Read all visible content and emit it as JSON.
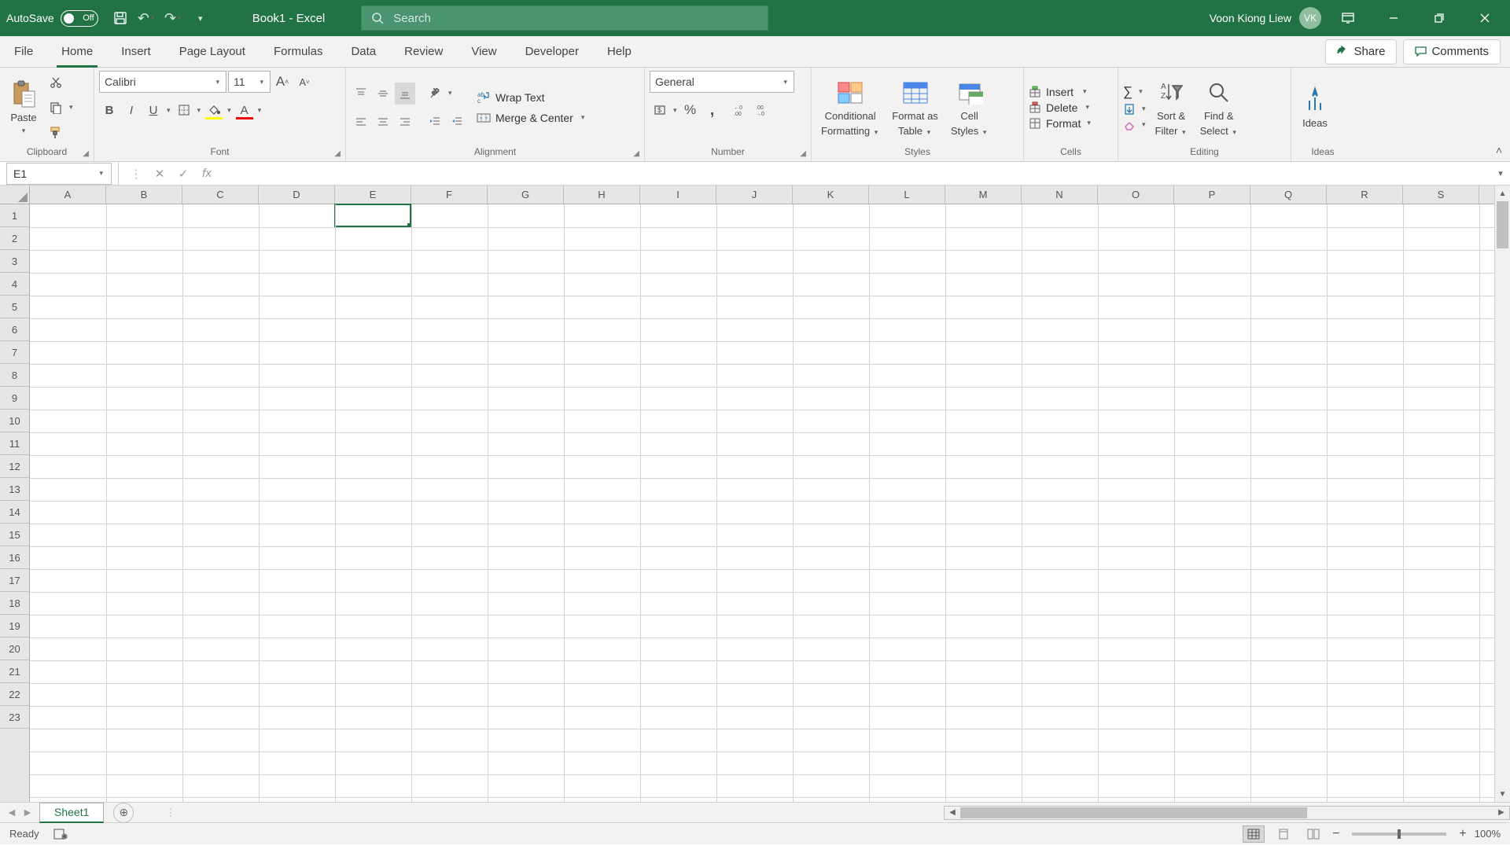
{
  "titlebar": {
    "autosave_label": "AutoSave",
    "autosave_state": "Off",
    "doc_title": "Book1  -  Excel",
    "search_placeholder": "Search",
    "user_name": "Voon Kiong Liew",
    "user_initials": "VK"
  },
  "tabs": [
    "File",
    "Home",
    "Insert",
    "Page Layout",
    "Formulas",
    "Data",
    "Review",
    "View",
    "Developer",
    "Help"
  ],
  "active_tab": "Home",
  "tab_actions": {
    "share": "Share",
    "comments": "Comments"
  },
  "ribbon": {
    "clipboard": {
      "label": "Clipboard",
      "paste": "Paste"
    },
    "font": {
      "label": "Font",
      "name": "Calibri",
      "size": "11"
    },
    "alignment": {
      "label": "Alignment",
      "wrap": "Wrap Text",
      "merge": "Merge & Center"
    },
    "number": {
      "label": "Number",
      "format": "General"
    },
    "styles": {
      "label": "Styles",
      "cond": "Conditional",
      "cond2": "Formatting",
      "fas": "Format as",
      "fas2": "Table",
      "cell": "Cell",
      "cell2": "Styles"
    },
    "cells": {
      "label": "Cells",
      "insert": "Insert",
      "delete": "Delete",
      "format": "Format"
    },
    "editing": {
      "label": "Editing",
      "sort": "Sort &",
      "sort2": "Filter",
      "find": "Find &",
      "find2": "Select"
    },
    "ideas": {
      "label": "Ideas",
      "btn": "Ideas"
    }
  },
  "name_box": "E1",
  "selected_cell": {
    "col": 4,
    "row": 0
  },
  "columns": [
    "A",
    "B",
    "C",
    "D",
    "E",
    "F",
    "G",
    "H",
    "I",
    "J",
    "K",
    "L",
    "M",
    "N",
    "O",
    "P",
    "Q",
    "R",
    "S"
  ],
  "row_count": 23,
  "sheet_tab": "Sheet1",
  "status": {
    "ready": "Ready",
    "zoom": "100%"
  },
  "colors": {
    "brand": "#217346"
  }
}
